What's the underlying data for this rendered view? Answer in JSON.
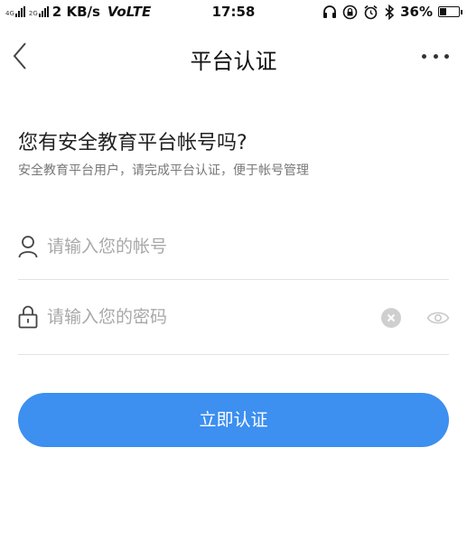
{
  "status_bar": {
    "network_small_1": "4G",
    "network_small_2": "2G",
    "speed": "2 KB/s",
    "volte": "VoLTE",
    "time": "17:58",
    "battery": "36%",
    "battery_level": 0.36
  },
  "nav": {
    "title": "平台认证",
    "back_icon": "chevron-left-icon",
    "more_icon": "more-horizontal-icon"
  },
  "heading": {
    "title": "您有安全教育平台帐号吗?",
    "subtitle": "安全教育平台用户，请完成平台认证，便于帐号管理"
  },
  "form": {
    "account": {
      "placeholder": "请输入您的帐号",
      "value": "",
      "icon": "user-icon"
    },
    "password": {
      "placeholder": "请输入您的密码",
      "value": "",
      "icon": "lock-icon",
      "clear_icon": "clear-icon",
      "visibility_icon": "eye-icon"
    }
  },
  "submit": {
    "label": "立即认证"
  },
  "colors": {
    "accent": "#3d8ff0",
    "divider": "#e2e2e2",
    "placeholder": "#a8a8a8"
  }
}
